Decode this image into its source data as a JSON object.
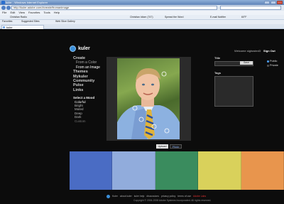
{
  "browser": {
    "title": "kuler - Windows Internet Explorer",
    "address": "http://kuler.adobe.com/#create/fromanimage",
    "menu": [
      "File",
      "Edit",
      "View",
      "Favorites",
      "Tools",
      "Help"
    ],
    "toolbar": {
      "search_label": "Christian Radio",
      "radio_label": "Christian Idiom (747)",
      "spread_label": "Spread the Word",
      "email_label": "E-mail Notifier",
      "temp_label": "60°F"
    },
    "links": {
      "favorites": "Favorites",
      "suggested": "Suggested Sites",
      "webslice": "Web Slice Gallery"
    },
    "tab_label": "kuler"
  },
  "app": {
    "logo": "kuler",
    "welcome": "Welcome slghosted3",
    "signout": "Sign Out",
    "nav": [
      {
        "label": "Create",
        "cls": "item"
      },
      {
        "label": "From a Color",
        "cls": "item sub"
      },
      {
        "label": "From an Image",
        "cls": "item sub active"
      },
      {
        "label": "Themes",
        "cls": "item"
      },
      {
        "label": "Mykuler",
        "cls": "item"
      },
      {
        "label": "Community",
        "cls": "item"
      },
      {
        "label": "Pulse",
        "cls": "item"
      },
      {
        "label": "Links",
        "cls": "item"
      }
    ],
    "mood": {
      "header": "Select a Mood",
      "options": [
        "Colorful",
        "Bright",
        "Muted",
        "Deep",
        "Dark",
        "Custom"
      ]
    },
    "upload_label": "Upload",
    "flickr_label": "Flickr",
    "title_label": "Title",
    "save_label": "Save",
    "public_label": "Public",
    "private_label": "Private",
    "tags_label": "Tags",
    "swatch_colors": [
      "#4a6cc4",
      "#91acdc",
      "#3a8c5e",
      "#d9d15b",
      "#e8954d"
    ],
    "footer": {
      "links": [
        "Kuler",
        "about kuler",
        "kuler help",
        "discussions",
        "privacy policy",
        "terms of use"
      ],
      "accent": "Adobe Labs",
      "copyright": "Copyright © 2006-2008 Adobe Systems Incorporated. All rights reserved."
    }
  }
}
